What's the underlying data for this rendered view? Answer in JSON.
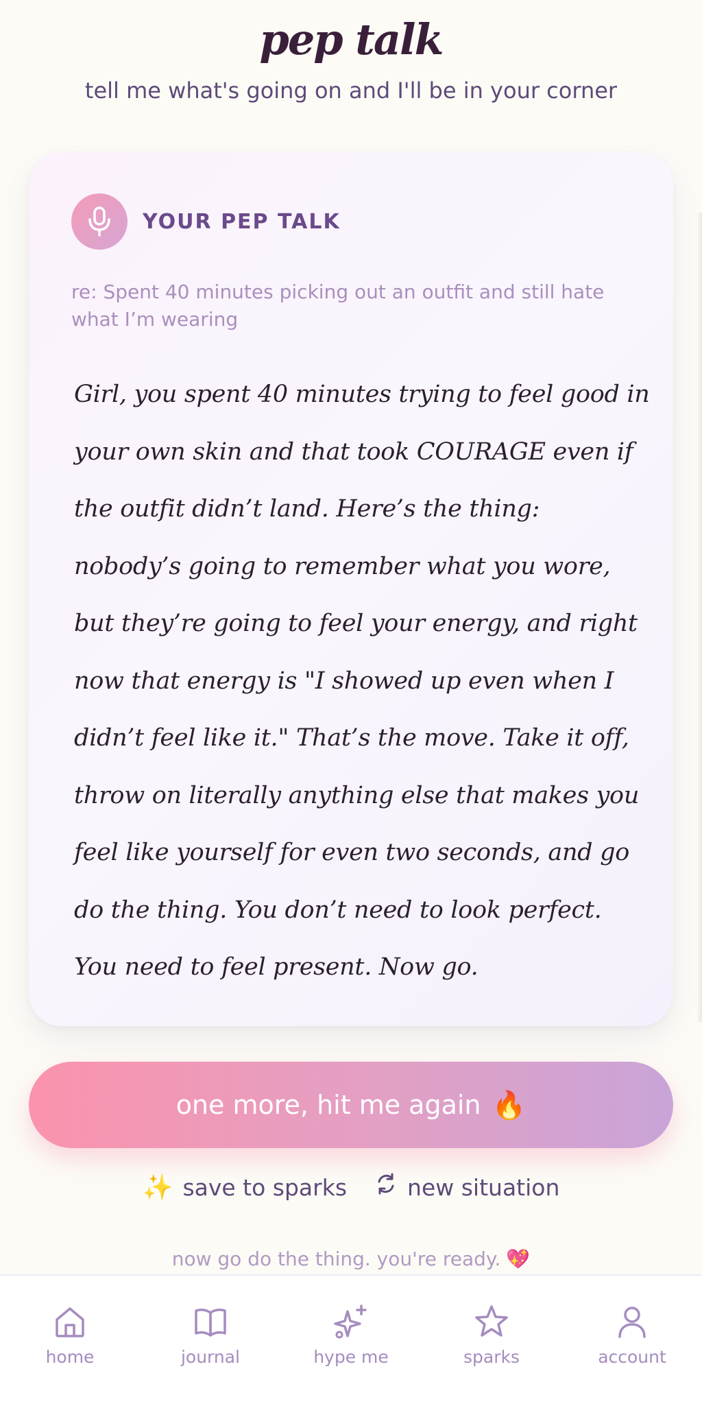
{
  "header": {
    "title": "pep talk",
    "subtitle": "tell me what's going on and I'll be in your corner"
  },
  "card": {
    "label": "YOUR PEP TALK",
    "icon": "microphone-icon",
    "context": "re: Spent 40 minutes picking out an outfit and still hate what I’m wearing",
    "message": "Girl, you spent 40 minutes trying to feel good in your own skin and that took COURAGE even if the outfit didn’t land. Here’s the thing: nobody’s going to remember what you wore, but they’re going to feel your energy, and right now that energy is \"I showed up even when I didn’t feel like it.\" That’s the move. Take it off, throw on literally anything else that makes you feel like yourself for even two seconds, and go do the thing. You don’t need to look perfect. You need to feel present. Now go."
  },
  "actions": {
    "primary_label": "one more, hit me again",
    "primary_emoji": "🔥",
    "save_label": "save to sparks",
    "save_emoji": "✨",
    "new_label": "new situation"
  },
  "footer_note": {
    "text": "now go do the thing. you're ready.",
    "emoji": "💖"
  },
  "tabbar": {
    "items": [
      {
        "label": "home",
        "icon": "home-icon"
      },
      {
        "label": "journal",
        "icon": "book-icon"
      },
      {
        "label": "hype me",
        "icon": "sparkle-icon"
      },
      {
        "label": "sparks",
        "icon": "star-icon"
      },
      {
        "label": "account",
        "icon": "user-icon"
      }
    ]
  },
  "colors": {
    "background": "#fcfbf6",
    "title": "#3a1f3a",
    "accent_pink": "#fb93ad",
    "accent_lavender": "#c9a4d8",
    "tab_inactive": "#a58cbf"
  }
}
